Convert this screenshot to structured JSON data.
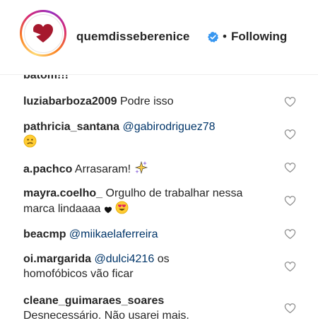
{
  "header": {
    "username": "quemdisseberenice",
    "separator": "•",
    "follow_status": "Following",
    "colors": {
      "brand": "#a6192e",
      "verified": "#3897f0"
    }
  },
  "comments": {
    "partial_text": "batom!!!",
    "items": [
      {
        "username": "luziabarboza2009",
        "text": "Podre isso",
        "mention": "",
        "text2": "",
        "emoji": ""
      },
      {
        "username": "pathricia_santana",
        "text": "",
        "mention": "@gabirodriguez78",
        "text2": "",
        "emoji": "confused-face"
      },
      {
        "username": "a.pachco",
        "text": "Arrasaram!",
        "mention": "",
        "text2": "",
        "emoji": "sparkles"
      },
      {
        "username": "mayra.coelho_",
        "text": "Orgulho de trabalhar nessa marca lindaaaa",
        "mention": "",
        "text2": "",
        "emoji": "black-heart, heart-eyes-face"
      },
      {
        "username": "beacmp",
        "text": "",
        "mention": "@miikaelaferreira",
        "text2": "",
        "emoji": ""
      },
      {
        "username": "oi.margarida",
        "text": "",
        "mention": "@dulci4216",
        "text2": "os homofóbicos vão ficar",
        "emoji": ""
      },
      {
        "username": "cleane_guimaraes_soares",
        "text": "Desnecessário. Não usarei mais.",
        "mention": "",
        "text2": "",
        "emoji": ""
      }
    ]
  },
  "icons": {
    "like": "heart-outline-icon",
    "verified": "verified-badge-icon"
  }
}
